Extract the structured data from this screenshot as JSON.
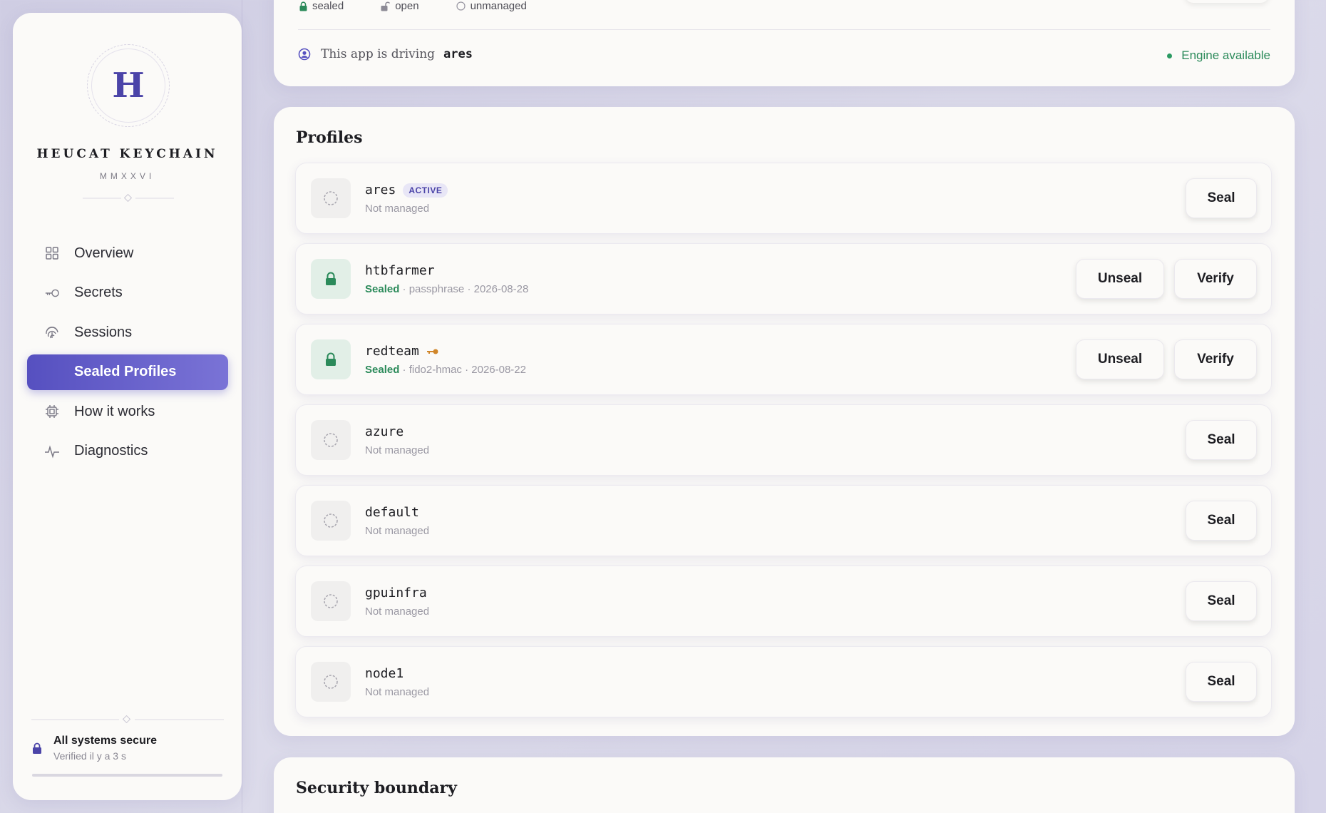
{
  "sidebar": {
    "logo_letter": "H",
    "brand": "HEUCAT KEYCHAIN",
    "brand_sub": "MMXXVI",
    "items": [
      {
        "label": "Overview",
        "icon": "grid-icon"
      },
      {
        "label": "Secrets",
        "icon": "key-icon"
      },
      {
        "label": "Sessions",
        "icon": "fingerprint-icon"
      },
      {
        "label": "Sealed Profiles",
        "icon": "lock-icon",
        "active": true
      },
      {
        "label": "How it works",
        "icon": "chip-icon"
      },
      {
        "label": "Diagnostics",
        "icon": "pulse-icon"
      }
    ],
    "status": {
      "title": "All systems secure",
      "subtitle": "Verified il y a 3 s"
    }
  },
  "top": {
    "legend": {
      "sealed": "sealed",
      "open": "open",
      "unmanaged": "unmanaged"
    },
    "driving_label": "This app is driving",
    "driving_profile": "ares",
    "engine_status": "Engine available"
  },
  "profiles": {
    "title": "Profiles",
    "active_badge": "ACTIVE",
    "rows": [
      {
        "name": "ares",
        "status": "Not managed",
        "sealed": false,
        "active": true,
        "buttons": [
          "Seal"
        ]
      },
      {
        "name": "htbfarmer",
        "status": "Sealed",
        "method": "· passphrase",
        "date": "· 2026-08-28",
        "sealed": true,
        "buttons": [
          "Unseal",
          "Verify"
        ]
      },
      {
        "name": "redteam",
        "status": "Sealed",
        "method": "· fido2-hmac",
        "date": "· 2026-08-22",
        "sealed": true,
        "key": true,
        "buttons": [
          "Unseal",
          "Verify"
        ]
      },
      {
        "name": "azure",
        "status": "Not managed",
        "sealed": false,
        "buttons": [
          "Seal"
        ]
      },
      {
        "name": "default",
        "status": "Not managed",
        "sealed": false,
        "buttons": [
          "Seal"
        ]
      },
      {
        "name": "gpuinfra",
        "status": "Not managed",
        "sealed": false,
        "buttons": [
          "Seal"
        ]
      },
      {
        "name": "node1",
        "status": "Not managed",
        "sealed": false,
        "buttons": [
          "Seal"
        ]
      }
    ]
  },
  "security": {
    "title": "Security boundary"
  },
  "colors": {
    "accent": "#5650c0",
    "sealed_green": "#2b8a5a",
    "key_orange": "#d0862a"
  }
}
